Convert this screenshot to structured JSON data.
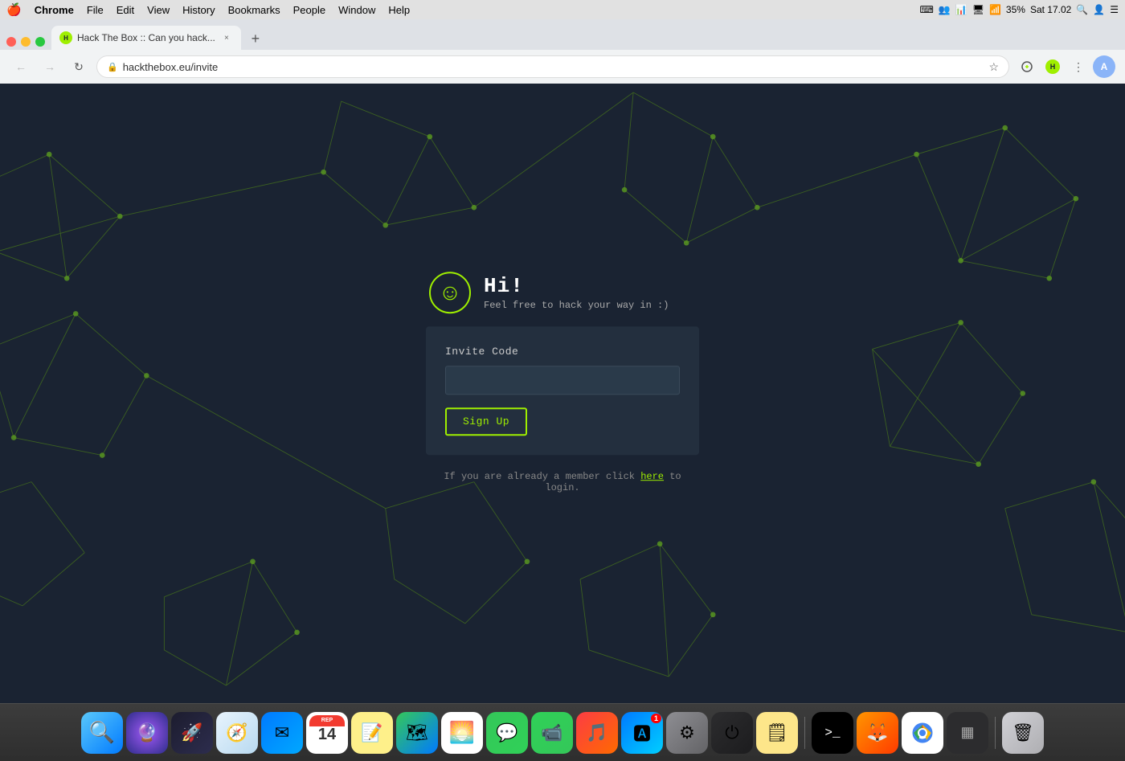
{
  "menubar": {
    "apple": "🍎",
    "items": [
      "Chrome",
      "File",
      "Edit",
      "View",
      "History",
      "Bookmarks",
      "People",
      "Window",
      "Help"
    ],
    "time": "Sat 17.02",
    "battery": "35%"
  },
  "browser": {
    "tab_title": "Hack The Box :: Can you hack...",
    "tab_favicon": "H",
    "address": "hackthebox.eu/invite",
    "new_tab_label": "+",
    "close_label": "×"
  },
  "page": {
    "greeting_hi": "Hi!",
    "greeting_sub": "Feel free to hack your way in :)",
    "smiley": "☺",
    "invite_label": "Invite Code",
    "invite_placeholder": "",
    "signup_label": "Sign Up",
    "login_text_before": "If you are already a member click ",
    "login_link": "here",
    "login_text_after": " to login."
  },
  "dock": {
    "items": [
      {
        "name": "finder",
        "emoji": "🔍",
        "bg": "#fff",
        "label": "Finder"
      },
      {
        "name": "siri",
        "emoji": "🔮",
        "bg": "#333",
        "label": "Siri"
      },
      {
        "name": "launchpad",
        "emoji": "🚀",
        "bg": "#111",
        "label": "Launchpad"
      },
      {
        "name": "safari",
        "emoji": "🧭",
        "bg": "#fff",
        "label": "Safari"
      },
      {
        "name": "mail",
        "emoji": "✉",
        "bg": "#3b9",
        "label": "Mail"
      },
      {
        "name": "calendar",
        "emoji": "📅",
        "bg": "#fff",
        "label": "Calendar"
      },
      {
        "name": "notes",
        "emoji": "📝",
        "bg": "#ffd",
        "label": "Notes"
      },
      {
        "name": "maps",
        "emoji": "🗺",
        "bg": "#2a8",
        "label": "Maps"
      },
      {
        "name": "photos",
        "emoji": "🌅",
        "bg": "#eee",
        "label": "Photos"
      },
      {
        "name": "messages",
        "emoji": "💬",
        "bg": "#2c2",
        "label": "Messages"
      },
      {
        "name": "facetime",
        "emoji": "📹",
        "bg": "#2a2",
        "label": "FaceTime"
      },
      {
        "name": "music",
        "emoji": "🎵",
        "bg": "#f50",
        "label": "Music"
      },
      {
        "name": "appstore",
        "emoji": "🅰",
        "bg": "#07f",
        "label": "App Store"
      },
      {
        "name": "sysprefs",
        "emoji": "⚙",
        "bg": "#888",
        "label": "System Preferences"
      },
      {
        "name": "power",
        "emoji": "⏻",
        "bg": "#333",
        "label": "Power"
      },
      {
        "name": "stickies",
        "emoji": "🗒",
        "bg": "#fd3",
        "label": "Stickies"
      },
      {
        "name": "terminal",
        "emoji": ">_",
        "bg": "#000",
        "label": "Terminal"
      },
      {
        "name": "firefox",
        "emoji": "🦊",
        "bg": "#fa0",
        "label": "Firefox"
      },
      {
        "name": "chrome",
        "emoji": "●",
        "bg": "#fff",
        "label": "Chrome"
      },
      {
        "name": "spaces",
        "emoji": "▦",
        "bg": "#333",
        "label": "Spaces"
      },
      {
        "name": "trash",
        "emoji": "🗑",
        "bg": "#ccc",
        "label": "Trash"
      }
    ]
  }
}
